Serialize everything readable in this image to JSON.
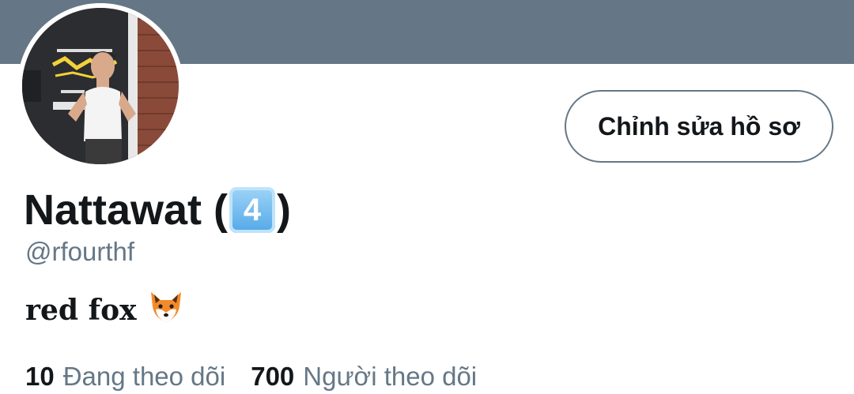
{
  "banner": {
    "color": "#657786"
  },
  "profile": {
    "avatar_icon": "profile-photo",
    "name": "Nattawat (",
    "name_emoji": "4",
    "name_suffix": ")",
    "handle": "@rfourthf",
    "bio_text": "red fox",
    "bio_emoji": "fox-face-icon"
  },
  "actions": {
    "edit_profile_label": "Chỉnh sửa hồ sơ"
  },
  "stats": {
    "following_count": "10",
    "following_label": "Đang theo dõi",
    "followers_count": "700",
    "followers_label": "Người theo dõi"
  },
  "colors": {
    "accent_gray": "#657786",
    "text_primary": "#14171a",
    "keycap_blue": "#52a8e8"
  }
}
